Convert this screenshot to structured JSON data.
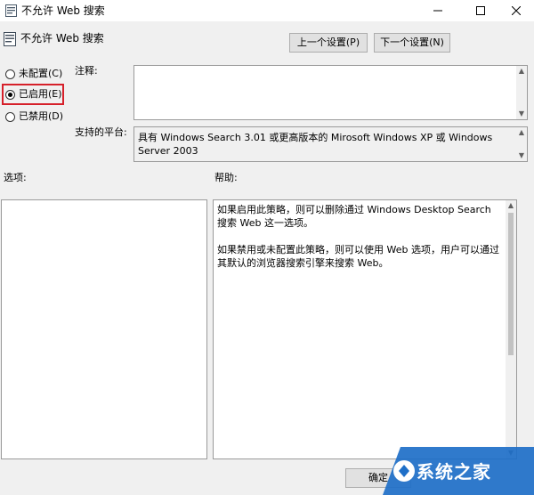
{
  "window": {
    "title": "不允许 Web 搜索",
    "minimize_glyph": "—",
    "maximize_glyph": "□",
    "close_glyph": "✕"
  },
  "policy": {
    "name": "不允许 Web 搜索"
  },
  "nav": {
    "prev_label": "上一个设置(P)",
    "next_label": "下一个设置(N)"
  },
  "state": {
    "options": [
      {
        "label": "未配置(C)",
        "checked": false
      },
      {
        "label": "已启用(E)",
        "checked": true
      },
      {
        "label": "已禁用(D)",
        "checked": false
      }
    ]
  },
  "comment": {
    "label": "注释:",
    "value": ""
  },
  "platform": {
    "label": "支持的平台:",
    "value": "具有 Windows Search 3.01 或更高版本的 Mirosoft Windows XP 或 Windows Server 2003"
  },
  "options_panel": {
    "label": "选项:"
  },
  "help_panel": {
    "label": "帮助:",
    "paragraphs": [
      "如果启用此策略，则可以删除通过 Windows Desktop Search 搜索 Web 这一选项。",
      "如果禁用或未配置此策略，则可以使用 Web 选项，用户可以通过其默认的浏览器搜索引擎来搜索 Web。"
    ]
  },
  "footer": {
    "ok_label": "确定"
  },
  "watermark": {
    "text": "系统之家"
  },
  "colors": {
    "highlight": "#d6202a",
    "window_bg": "#f0f0f0",
    "watermark_bg": "#1e6fc8"
  }
}
